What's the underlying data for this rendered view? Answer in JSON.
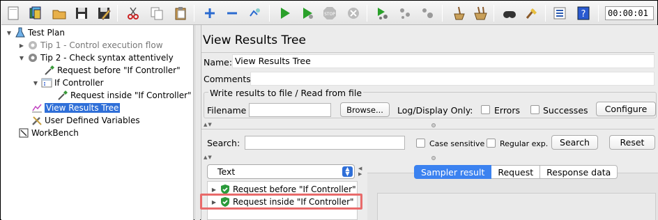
{
  "toolbar": {
    "timer": "00:00:01",
    "buttons": [
      "new-icon",
      "templates-icon",
      "open-icon",
      "save-icon",
      "save-as-icon",
      "cut-icon",
      "copy-icon",
      "paste-icon",
      "expand-icon",
      "collapse-icon",
      "toggle-icon",
      "start-icon",
      "start-no-pauses-icon",
      "stop-icon",
      "shutdown-icon",
      "remote-start-icon",
      "remote-stop-icon",
      "remote-shutdown-icon",
      "clear-icon",
      "clear-all-icon",
      "search-icon",
      "reset-search-icon",
      "function-helper-icon",
      "help-icon"
    ]
  },
  "tree": {
    "items": [
      {
        "label": "Test Plan",
        "icon": "test-plan-icon"
      },
      {
        "label": "Tip 1 - Control execution flow",
        "icon": "gear-icon"
      },
      {
        "label": "Tip 2 - Check syntax attentively",
        "icon": "gear-icon"
      },
      {
        "label": "Request before \"If Controller\"",
        "icon": "sampler-pipette-icon"
      },
      {
        "label": "If Controller",
        "icon": "if-controller-icon"
      },
      {
        "label": "Request inside \"If Controller\"",
        "icon": "sampler-pipette-icon"
      },
      {
        "label": "View Results Tree",
        "icon": "chart-icon"
      },
      {
        "label": "User Defined Variables",
        "icon": "wrench-icon"
      },
      {
        "label": "WorkBench",
        "icon": "workbench-icon"
      }
    ]
  },
  "panel": {
    "title": "View Results Tree",
    "name_label": "Name:",
    "name_value": "View Results Tree",
    "comments_label": "Comments:",
    "file_group_title": "Write results to file / Read from file",
    "filename_label": "Filename",
    "browse_label": "Browse...",
    "log_display_label": "Log/Display Only:",
    "errors_label": "Errors",
    "successes_label": "Successes",
    "configure_label": "Configure",
    "search_label": "Search:",
    "case_sensitive_label": "Case sensitive",
    "regex_label": "Regular exp.",
    "search_button": "Search",
    "reset_button": "Reset",
    "renderer_selected": "Text",
    "results": [
      {
        "label": "Request before \"If Controller\""
      },
      {
        "label": "Request inside \"If Controller\""
      }
    ],
    "tabs": [
      "Sampler result",
      "Request",
      "Response data"
    ]
  }
}
